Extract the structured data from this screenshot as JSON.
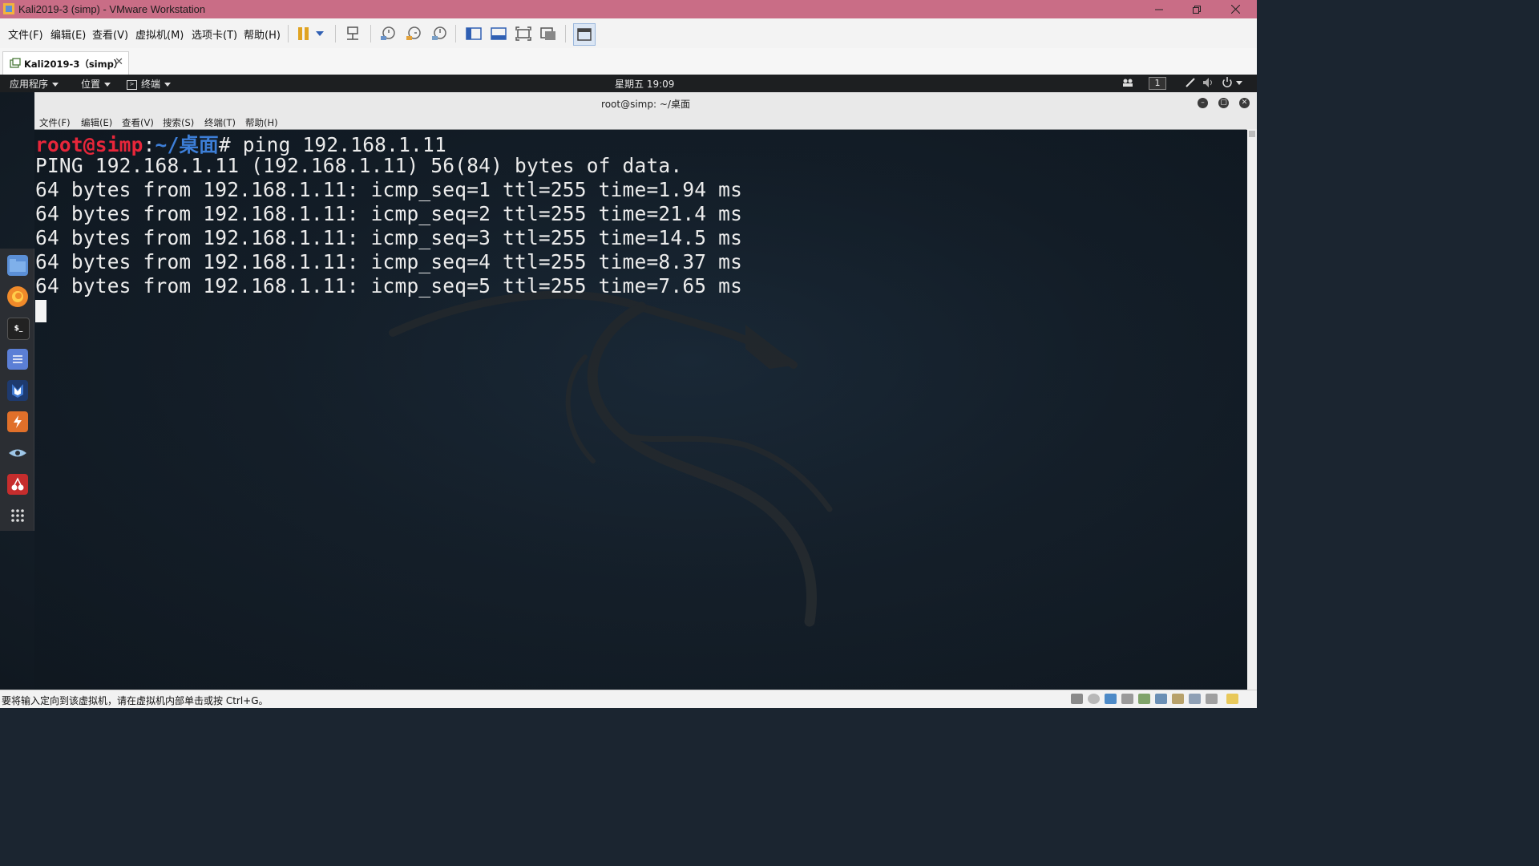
{
  "vmware": {
    "title": "Kali2019-3  (simp)  - VMware Workstation",
    "menu": [
      "文件(F)",
      "编辑(E)",
      "查看(V)",
      "虚拟机(M)",
      "选项卡(T)",
      "帮助(H)"
    ],
    "tab_label": "Kali2019-3（simp）",
    "status_message": "要将输入定向到该虚拟机，请在虚拟机内部单击或按 Ctrl+G。"
  },
  "kali_panel": {
    "applications": "应用程序",
    "places": "位置",
    "terminal": "终端",
    "clock": "星期五 19:09",
    "workspace": "1"
  },
  "terminal": {
    "title": "root@simp: ~/桌面",
    "menu": [
      "文件(F)",
      "编辑(E)",
      "查看(V)",
      "搜索(S)",
      "终端(T)",
      "帮助(H)"
    ],
    "prompt_user": "root@simp",
    "prompt_sep": ":",
    "prompt_path": "~/桌面",
    "prompt_symbol": "# ",
    "command": "ping 192.168.1.11",
    "output": [
      "PING 192.168.1.11 (192.168.1.11) 56(84) bytes of data.",
      "64 bytes from 192.168.1.11: icmp_seq=1 ttl=255 time=1.94 ms",
      "64 bytes from 192.168.1.11: icmp_seq=2 ttl=255 time=21.4 ms",
      "64 bytes from 192.168.1.11: icmp_seq=3 ttl=255 time=14.5 ms",
      "64 bytes from 192.168.1.11: icmp_seq=4 ttl=255 time=8.37 ms",
      "64 bytes from 192.168.1.11: icmp_seq=5 ttl=255 time=7.65 ms"
    ]
  },
  "dock_icons": [
    "files-icon",
    "firefox-icon",
    "terminal-icon",
    "text-editor-icon",
    "metasploit-icon",
    "burpsuite-icon",
    "eye-icon",
    "cherrytree-icon",
    "show-apps-icon"
  ],
  "colors": {
    "vm_titlebar": "#c96d86",
    "prompt_user": "#e8263a",
    "prompt_path": "#3d7fd8"
  }
}
